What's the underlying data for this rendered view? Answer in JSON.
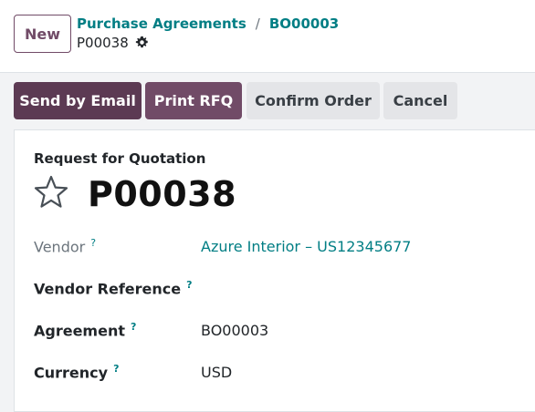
{
  "header": {
    "new_label": "New",
    "breadcrumb": [
      "Purchase Agreements",
      "BO00003"
    ],
    "breadcrumb_sep": "/",
    "record_name": "P00038"
  },
  "toolbar": {
    "send_email": "Send by Email",
    "print_rfq": "Print RFQ",
    "confirm_order": "Confirm Order",
    "cancel": "Cancel"
  },
  "form": {
    "doc_type": "Request for Quotation",
    "title": "P00038",
    "help_mark": "?",
    "fields": {
      "vendor": {
        "label": "Vendor",
        "value": "Azure Interior – US12345677"
      },
      "vendor_ref": {
        "label": "Vendor Reference",
        "value": ""
      },
      "agreement": {
        "label": "Agreement",
        "value": "BO00003"
      },
      "currency": {
        "label": "Currency",
        "value": "USD"
      }
    }
  },
  "colors": {
    "primary": "#714b67",
    "link": "#017e84"
  },
  "icons": [
    "gear-icon",
    "star-icon"
  ]
}
